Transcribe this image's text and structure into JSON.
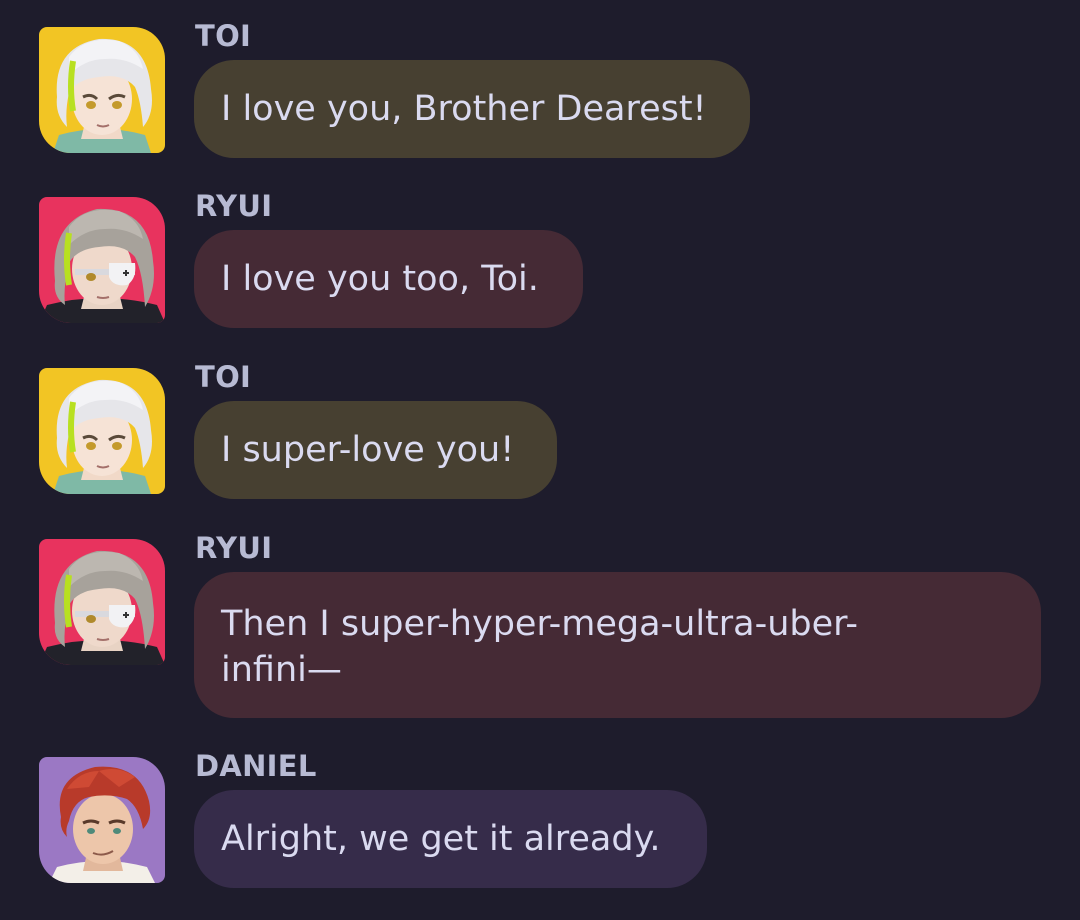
{
  "messages": [
    {
      "sender": "TOI",
      "text": "I love you, Brother Dearest!",
      "avatar": "toi-avatar",
      "style": "toi"
    },
    {
      "sender": "RYUI",
      "text": "I love you too, Toi.",
      "avatar": "ryui-avatar",
      "style": "ryui"
    },
    {
      "sender": "TOI",
      "text": "I super-love you!",
      "avatar": "toi-avatar",
      "style": "toi"
    },
    {
      "sender": "RYUI",
      "text": "Then I super-hyper-mega-ultra-uber-infini—",
      "avatar": "ryui-avatar",
      "style": "ryui"
    },
    {
      "sender": "DANIEL",
      "text": "Alright, we get it already.",
      "avatar": "daniel-avatar",
      "style": "daniel"
    }
  ],
  "colors": {
    "background": "#1e1c2c",
    "sender_label": "#b7bad3",
    "message_text": "#dadaf0",
    "toi_bubble": "#474031",
    "ryui_bubble": "#452a35",
    "daniel_bubble": "#362c4a",
    "toi_avatar_bg": "#f2c524",
    "ryui_avatar_bg": "#e8335e",
    "daniel_avatar_bg": "#9b78c4"
  }
}
